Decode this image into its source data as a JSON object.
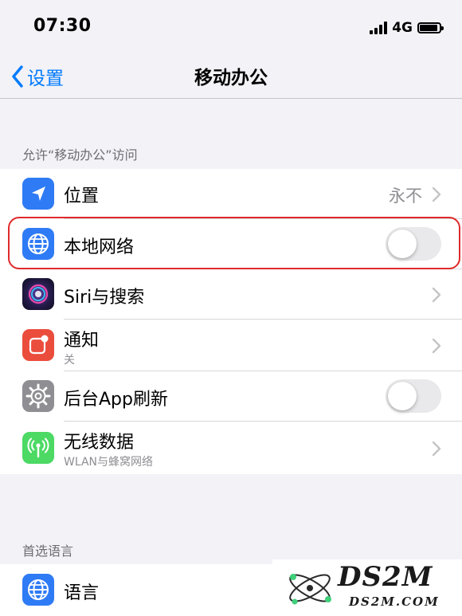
{
  "status_bar": {
    "time": "07:30",
    "network": "4G"
  },
  "nav": {
    "back_label": "设置",
    "title": "移动办公"
  },
  "sections": {
    "allow_header": "允许“移动办公”访问",
    "language_header": "首选语言"
  },
  "rows": {
    "location": {
      "label": "位置",
      "value": "永不",
      "icon": "location-arrow-icon"
    },
    "local_network": {
      "label": "本地网络",
      "toggle_on": false,
      "icon": "globe-icon"
    },
    "siri": {
      "label": "Siri与搜索",
      "icon": "siri-icon"
    },
    "notifications": {
      "label": "通知",
      "sub": "关",
      "icon": "notification-icon"
    },
    "background_refresh": {
      "label": "后台App刷新",
      "toggle_on": false,
      "icon": "gear-icon"
    },
    "wireless_data": {
      "label": "无线数据",
      "sub": "WLAN与蜂窝网络",
      "icon": "antenna-icon"
    },
    "language": {
      "label": "语言",
      "icon": "globe-icon"
    }
  },
  "watermark": {
    "main": "DS2M",
    "sub": "DS2M.COM"
  },
  "colors": {
    "accent": "#007aff",
    "background": "#f2f2f7",
    "highlight": "#e02a2a",
    "location_icon": "#2f7bf5",
    "network_icon": "#2f7bf5",
    "notification_icon": "#eb4d3d",
    "refresh_icon": "#8e8e93",
    "wireless_icon": "#4cd964"
  }
}
